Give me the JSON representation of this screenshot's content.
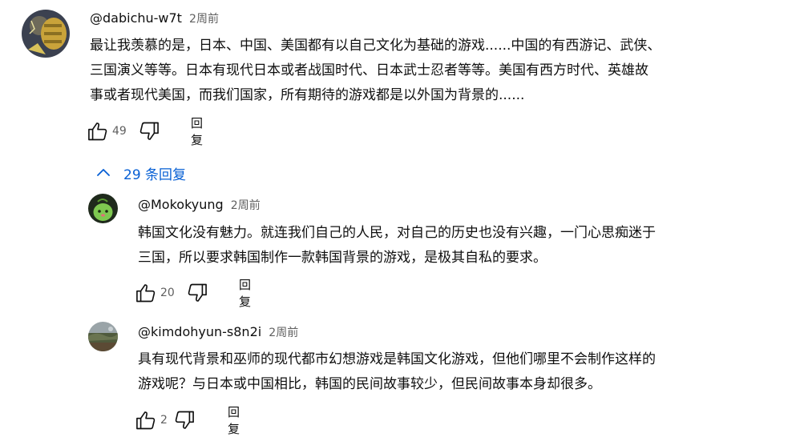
{
  "comment": {
    "author": "@dabichu-w7t",
    "time": "2周前",
    "text_lines": [
      "最让我羡慕的是，日本、中国、美国都有以自己文化为基础的游戏......中国的有西游记、武侠、",
      "三国演义等等。日本有现代日本或者战国时代、日本武士忍者等等。美国有西方时代、英雄故",
      "事或者现代美国，而我们国家，所有期待的游戏都是以外国为背景的......"
    ],
    "likes": "49",
    "reply_label": "回复",
    "like_icon": "thumb-up-icon",
    "dislike_icon": "thumb-down-icon"
  },
  "replies_toggle": {
    "label": "29 条回复",
    "icon": "chevron-up-icon",
    "color": "#065fd4"
  },
  "replies": [
    {
      "author": "@Mokokyung",
      "time": "2周前",
      "text_lines": [
        "韩国文化没有魅力。就连我们自己的人民，对自己的历史也没有兴趣，一门心思痴迷于",
        "三国，所以要求韩国制作一款韩国背景的游戏，是极其自私的要求。"
      ],
      "likes": "20",
      "reply_label": "回复"
    },
    {
      "author": "@kimdohyun-s8n2i",
      "time": "2周前",
      "text_lines": [
        "具有现代背景和巫师的现代都市幻想游戏是韩国文化游戏，但他们哪里不会制作这样的",
        "游戏呢？与日本或中国相比，韩国的民间故事较少，但民间故事本身却很多。"
      ],
      "likes": "2",
      "reply_label": "回复"
    }
  ]
}
